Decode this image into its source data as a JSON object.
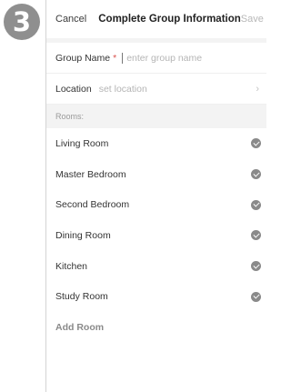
{
  "step_badge": "3",
  "header": {
    "cancel_label": "Cancel",
    "title": "Complete Group Information",
    "save_label": "Save"
  },
  "group_name": {
    "label": "Group Name",
    "required_mark": "*",
    "placeholder": "enter group name",
    "value": ""
  },
  "location": {
    "label": "Location",
    "value": "set location",
    "chevron_icon": "chevron-right-icon"
  },
  "rooms": {
    "header": "Rooms:",
    "items": [
      {
        "label": "Living Room",
        "checked": true
      },
      {
        "label": "Master Bedroom",
        "checked": true
      },
      {
        "label": "Second Bedroom",
        "checked": true
      },
      {
        "label": "Dining Room",
        "checked": true
      },
      {
        "label": "Kitchen",
        "checked": true
      },
      {
        "label": "Study Room",
        "checked": true
      }
    ],
    "add_label": "Add Room"
  },
  "colors": {
    "badge": "#8f8f8f",
    "check": "#8a8a8a",
    "required": "#d9534f",
    "section_bg": "#f3f3f3"
  }
}
